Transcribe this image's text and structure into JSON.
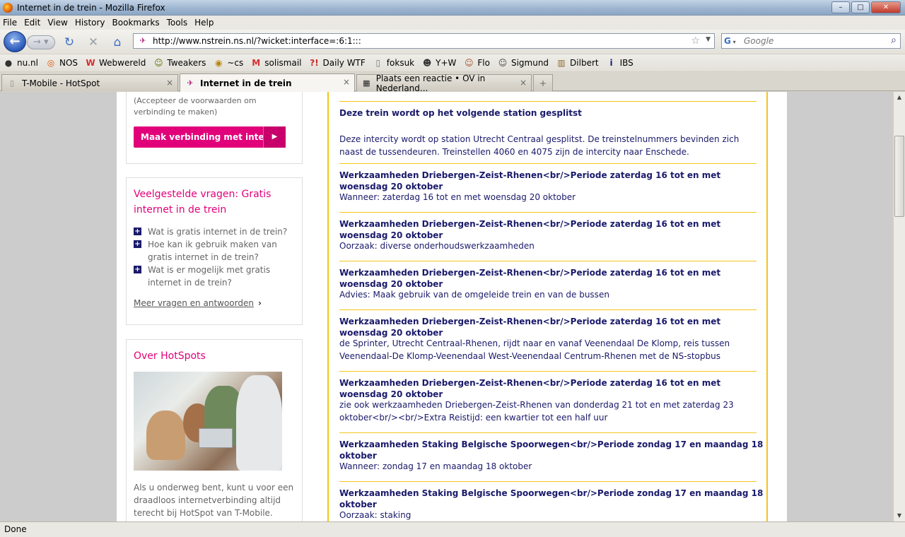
{
  "window": {
    "title": "Internet in de trein - Mozilla Firefox",
    "btn_min": "–",
    "btn_max": "□",
    "btn_close": "✕"
  },
  "menu": [
    "File",
    "Edit",
    "View",
    "History",
    "Bookmarks",
    "Tools",
    "Help"
  ],
  "nav": {
    "url": "http://www.nstrein.ns.nl/?wicket:interface=:6:1:::",
    "search_placeholder": "Google",
    "search_engine": "G"
  },
  "bookmarks": [
    {
      "label": "nu.nl",
      "icon": "nu-icon",
      "glyph": "●",
      "color": "#333"
    },
    {
      "label": "NOS",
      "icon": "nos-icon",
      "glyph": "◎",
      "color": "#e65100"
    },
    {
      "label": "Webwereld",
      "icon": "webwereld-icon",
      "glyph": "W",
      "color": "#d32f2f"
    },
    {
      "label": "Tweakers",
      "icon": "tweakers-icon",
      "glyph": "☺",
      "color": "#5a6e00"
    },
    {
      "label": "~cs",
      "icon": "cs-icon",
      "glyph": "◉",
      "color": "#b8860b"
    },
    {
      "label": "solismail",
      "icon": "gmail-icon",
      "glyph": "M",
      "color": "#d32f2f"
    },
    {
      "label": "Daily WTF",
      "icon": "dailywtf-icon",
      "glyph": "?!",
      "color": "#c62828"
    },
    {
      "label": "foksuk",
      "icon": "page-icon",
      "glyph": "▯",
      "color": "#777"
    },
    {
      "label": "Y+W",
      "icon": "yw-icon",
      "glyph": "☻",
      "color": "#333"
    },
    {
      "label": "Flo",
      "icon": "flo-icon",
      "glyph": "☺",
      "color": "#a0522d"
    },
    {
      "label": "Sigmund",
      "icon": "sigmund-icon",
      "glyph": "☺",
      "color": "#444"
    },
    {
      "label": "Dilbert",
      "icon": "dilbert-icon",
      "glyph": "▥",
      "color": "#8b6a2f"
    },
    {
      "label": "IBS",
      "icon": "ibs-icon",
      "glyph": "i",
      "color": "#1a237e"
    }
  ],
  "tabs": [
    {
      "label": "T-Mobile - HotSpot",
      "close": "×"
    },
    {
      "label": "Internet in de trein",
      "close": "×"
    },
    {
      "label": "Plaats een reactie • OV in Nederland...",
      "close": "×"
    }
  ],
  "new_tab": "+",
  "sidebar": {
    "terms_text": "(Accepteer de voorwaarden om verbinding te maken)",
    "connect_button": "Maak verbinding met internet",
    "connect_arrow": "▶",
    "faq_title": "Veelgestelde vragen: Gratis internet in de trein",
    "faq_items": [
      "Wat is gratis internet in de trein?",
      "Hoe kan ik gebruik maken van gratis internet in de trein?",
      "Wat is er mogelijk met gratis internet in de trein?"
    ],
    "faq_plus": "+",
    "more_link": "Meer vragen en antwoorden",
    "more_chevron": "›",
    "hotspots_title": "Over HotSpots",
    "hotspots_text": "Als u onderweg bent, kunt u voor een draadloos internetverbinding altijd terecht bij HotSpot van T-Mobile."
  },
  "news": [
    {
      "title": "Deze trein wordt op het volgende station gesplitst",
      "body": "Deze intercity wordt op station Utrecht Centraal gesplitst. De treinstelnummers bevinden zich naast de tussendeuren. Treinstellen 4060 en 4075 zijn de intercity naar Enschede."
    },
    {
      "title": "Werkzaamheden Driebergen-Zeist-Rhenen<br/>Periode zaterdag 16 tot en met woensdag 20 oktober",
      "body": "Wanneer: zaterdag 16 tot en met woensdag 20 oktober"
    },
    {
      "title": "Werkzaamheden Driebergen-Zeist-Rhenen<br/>Periode zaterdag 16 tot en met woensdag 20 oktober",
      "body": "Oorzaak: diverse onderhoudswerkzaamheden"
    },
    {
      "title": "Werkzaamheden Driebergen-Zeist-Rhenen<br/>Periode zaterdag 16 tot en met woensdag 20 oktober",
      "body": "Advies: Maak gebruik van de omgeleide trein en van de bussen"
    },
    {
      "title": "Werkzaamheden Driebergen-Zeist-Rhenen<br/>Periode zaterdag 16 tot en met woensdag 20 oktober",
      "body": "de Sprinter, Utrecht Centraal-Rhenen, rijdt naar en vanaf Veenendaal De Klomp, reis tussen Veenendaal-De Klomp-Veenendaal West-Veenendaal Centrum-Rhenen met de NS-stopbus"
    },
    {
      "title": "Werkzaamheden Driebergen-Zeist-Rhenen<br/>Periode zaterdag 16 tot en met woensdag 20 oktober",
      "body": "zie ook werkzaamheden Driebergen-Zeist-Rhenen van donderdag 21 tot en met zaterdag 23 oktober<br/><br/>Extra Reistijd: een kwartier tot een half uur"
    },
    {
      "title": "Werkzaamheden Staking Belgische Spoorwegen<br/>Periode zondag 17 en maandag 18 oktober",
      "body": "Wanneer: zondag 17 en maandag 18 oktober"
    },
    {
      "title": "Werkzaamheden Staking Belgische Spoorwegen<br/>Periode zondag 17 en maandag 18 oktober",
      "body": "Oorzaak: staking"
    }
  ],
  "status": "Done"
}
